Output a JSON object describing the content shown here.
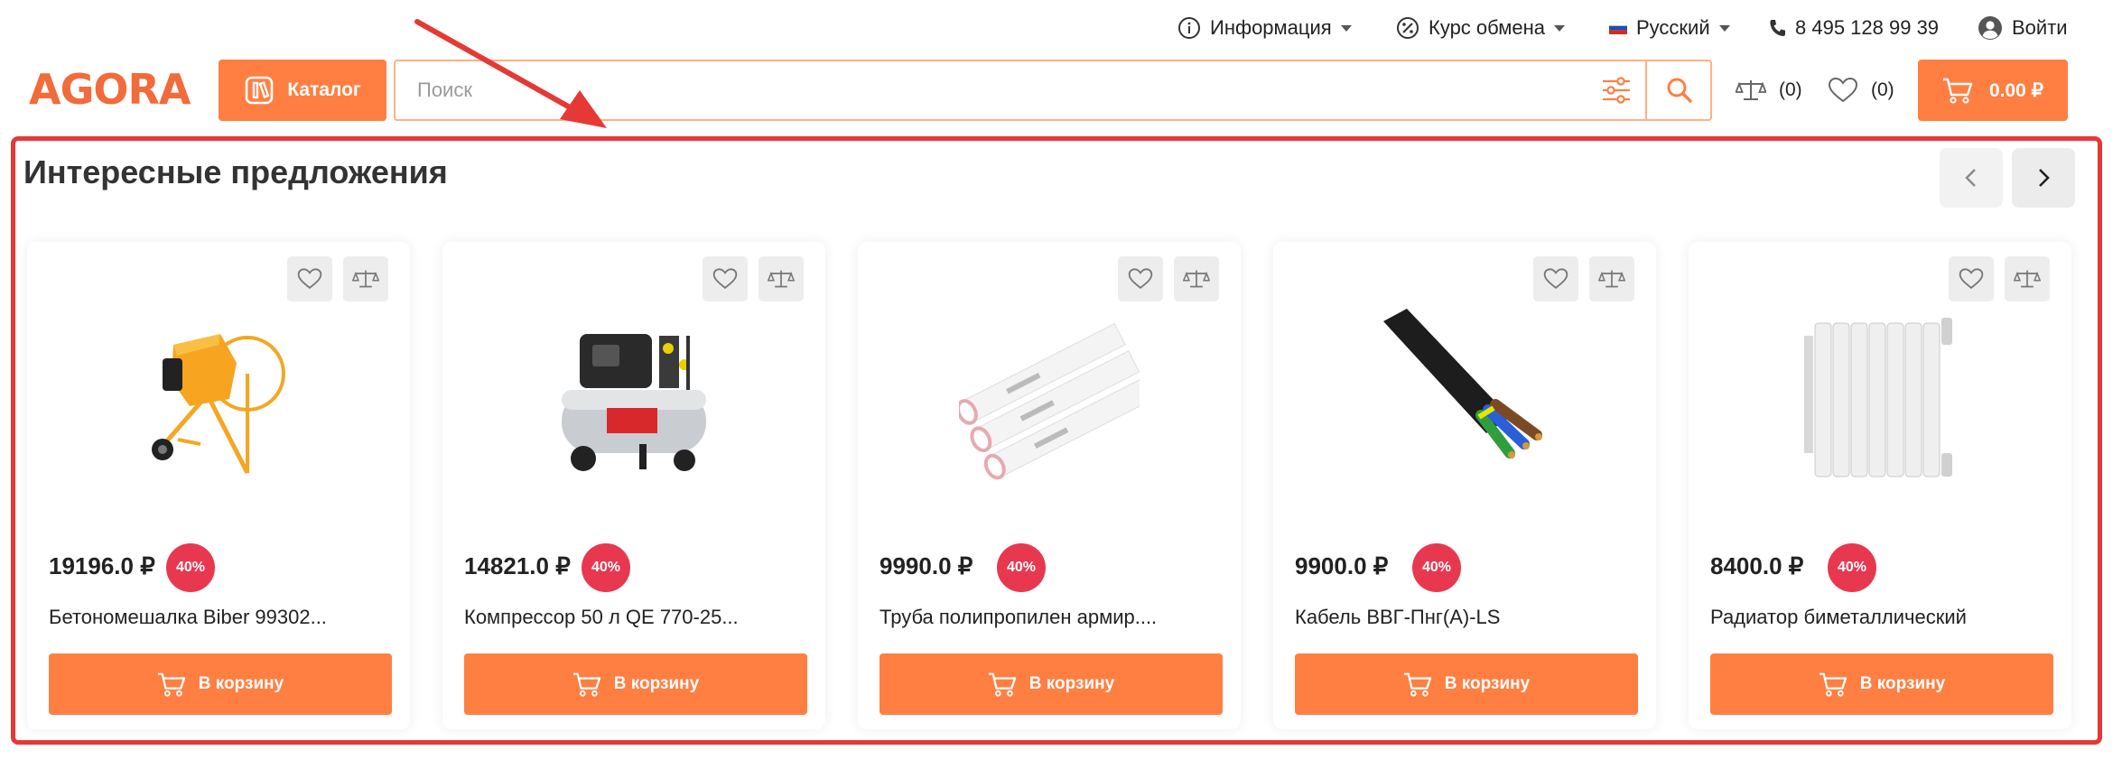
{
  "topbar": {
    "info_label": "Информация",
    "exchange_label": "Курс обмена",
    "language_label": "Русский",
    "phone": "8 495 128 99 39",
    "login_label": "Войти"
  },
  "header": {
    "logo_text": "AGORA",
    "catalog_label": "Каталог",
    "search_placeholder": "Поиск",
    "compare_count": "(0)",
    "favorites_count": "(0)",
    "cart_total": "0.00 ₽"
  },
  "section": {
    "title": "Интересные предложения"
  },
  "products": [
    {
      "price": "19196.0 ₽",
      "discount": "40%",
      "name": "Бетономешалка Biber 99302...",
      "button": "В корзину",
      "image": "concrete-mixer"
    },
    {
      "price": "14821.0 ₽",
      "discount": "40%",
      "name": "Компрессор 50 л QE 770-25...",
      "button": "В корзину",
      "image": "air-compressor"
    },
    {
      "price": "9990.0 ₽",
      "discount": "40%",
      "name": "Труба полипропилен армир....",
      "button": "В корзину",
      "image": "pp-pipes"
    },
    {
      "price": "9900.0 ₽",
      "discount": "40%",
      "name": "Кабель ВВГ-Пнг(А)-LS",
      "button": "В корзину",
      "image": "power-cable"
    },
    {
      "price": "8400.0 ₽",
      "discount": "40%",
      "name": "Радиатор биметаллический",
      "button": "В корзину",
      "image": "radiator"
    }
  ],
  "colors": {
    "accent": "#ff7f42",
    "discount": "#e8384f",
    "annotation": "#e53935"
  }
}
